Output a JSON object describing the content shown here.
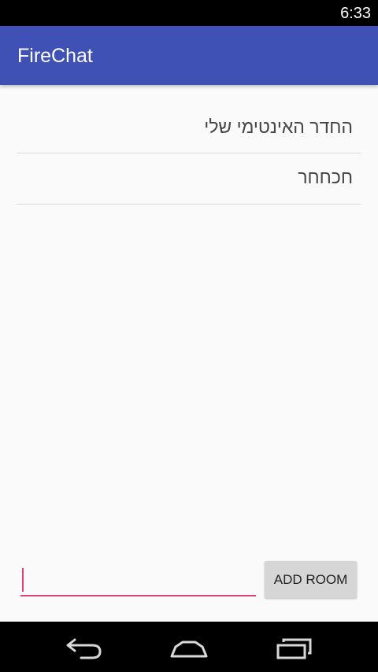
{
  "status_bar": {
    "time": "6:33"
  },
  "app_bar": {
    "title": "FireChat",
    "color": "#3f51b5"
  },
  "rooms": [
    {
      "label": "החדר האינטימי שלי"
    },
    {
      "label": "חכחחר"
    }
  ],
  "add_room": {
    "input_value": "",
    "button_label": "ADD ROOM",
    "accent_color": "#e0407a"
  },
  "nav_bar": {
    "back_icon": "back-icon",
    "home_icon": "home-icon",
    "recents_icon": "recents-icon"
  }
}
